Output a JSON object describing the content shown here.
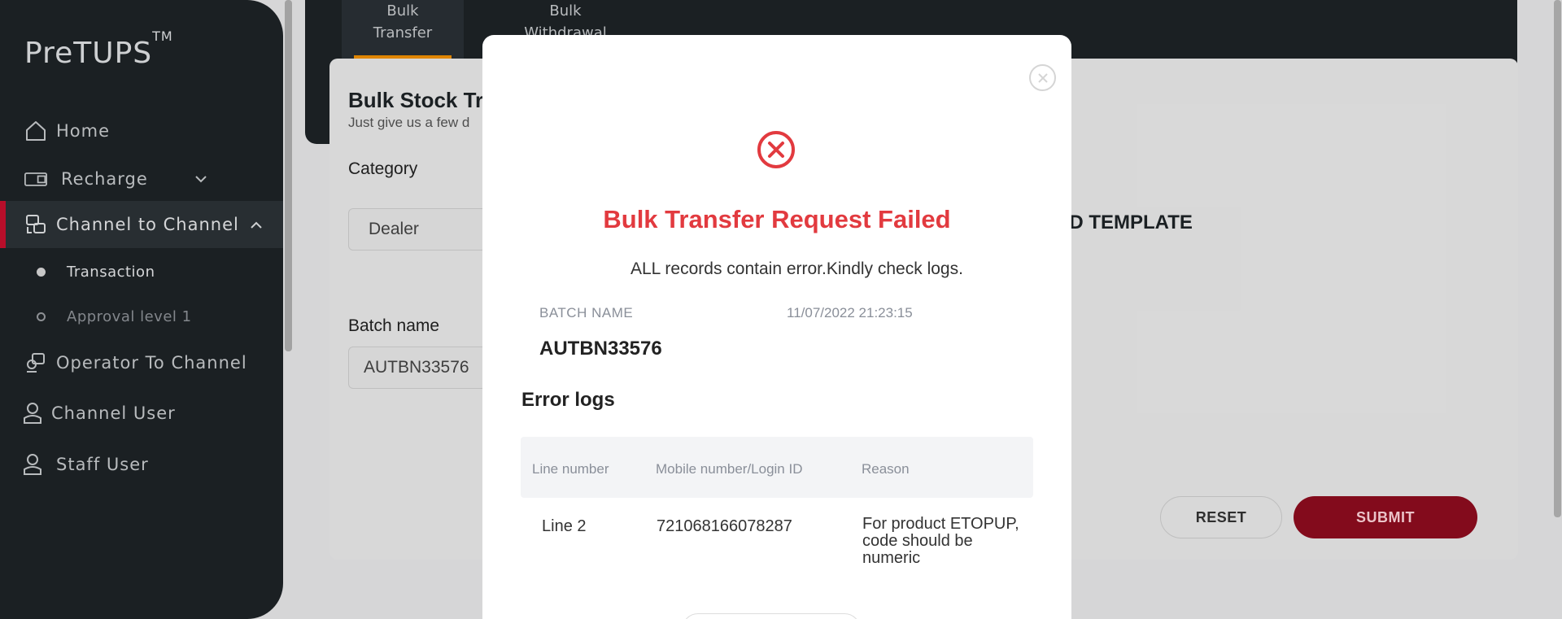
{
  "app": {
    "logo": "PreTUPS",
    "logo_tm": "TM"
  },
  "sidebar": {
    "items": [
      {
        "label": "Home",
        "icon": "home-icon"
      },
      {
        "label": "Recharge",
        "icon": "recharge-card-icon",
        "chevron": "chevron-down-icon"
      },
      {
        "label": "Channel to Channel",
        "icon": "channel-transfer-icon",
        "chevron": "chevron-up-icon",
        "active": true
      },
      {
        "label": "Operator To Channel",
        "icon": "operator-transfer-icon"
      },
      {
        "label": "Channel User",
        "icon": "user-icon"
      },
      {
        "label": "Staff User",
        "icon": "user-icon"
      }
    ],
    "sub_items": [
      {
        "label": "Transaction",
        "active": true
      },
      {
        "label": "Approval level 1",
        "active": false
      }
    ]
  },
  "tabs": [
    {
      "line1": "Bulk",
      "line2": "Transfer",
      "active": true
    },
    {
      "line1": "Bulk",
      "line2": "Withdrawal",
      "active": false
    }
  ],
  "form": {
    "title": "Bulk Stock Tra",
    "subtitle": "Just give us a few d",
    "category_label": "Category",
    "category_value": "Dealer",
    "batch_label": "Batch name",
    "batch_value": "AUTBN33576",
    "download_template": "AD TEMPLATE",
    "reset_label": "RESET",
    "submit_label": "SUBMIT"
  },
  "modal": {
    "title": "Bulk Transfer Request Failed",
    "message": "ALL records contain error.Kindly check logs.",
    "batch_name_label": "BATCH NAME",
    "batch_datetime": "11/07/2022 21:23:15",
    "batch_name_value": "AUTBN33576",
    "error_logs_title": "Error logs",
    "columns": [
      "Line number",
      "Mobile number/Login ID",
      "Reason"
    ],
    "rows": [
      {
        "line": "Line 2",
        "mobile": "721068166078287",
        "reason": "For product ETOPUP, code should be numeric"
      }
    ]
  },
  "colors": {
    "sidebar_bg": "#1e2327",
    "accent_red": "#c8102e",
    "error_red": "#e23a3f",
    "tab_underline": "#f29100",
    "submit_bg": "#8f0d1f"
  }
}
